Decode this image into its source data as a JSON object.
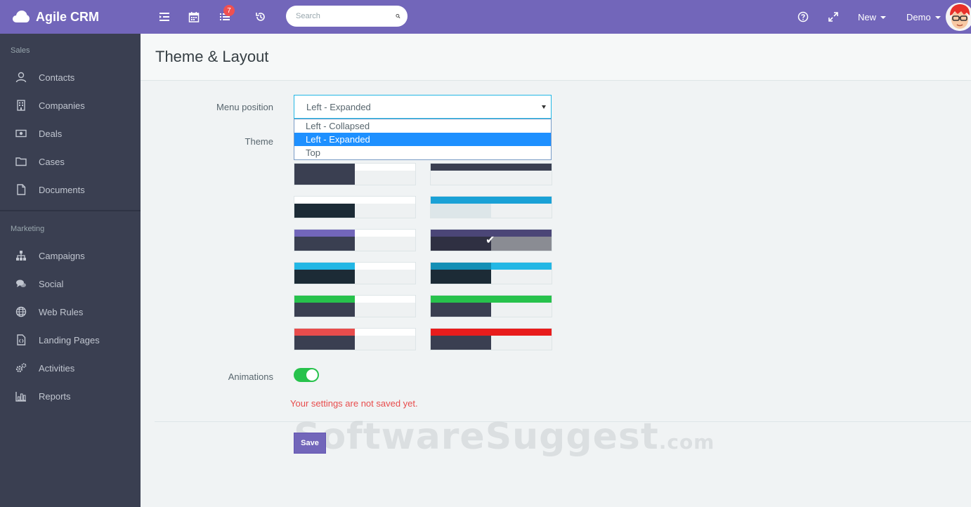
{
  "app": {
    "brand": "Agile CRM"
  },
  "topbar": {
    "notification_count": "7",
    "search_placeholder": "Search",
    "new_label": "New",
    "user_label": "Demo"
  },
  "sidebar": {
    "sales_section": "Sales",
    "sales_items": [
      {
        "label": "Contacts",
        "icon": "user-icon"
      },
      {
        "label": "Companies",
        "icon": "building-icon"
      },
      {
        "label": "Deals",
        "icon": "money-icon"
      },
      {
        "label": "Cases",
        "icon": "folder-icon"
      },
      {
        "label": "Documents",
        "icon": "file-icon"
      }
    ],
    "marketing_section": "Marketing",
    "marketing_items": [
      {
        "label": "Campaigns",
        "icon": "sitemap-icon"
      },
      {
        "label": "Social",
        "icon": "comments-icon"
      },
      {
        "label": "Web Rules",
        "icon": "globe-icon"
      },
      {
        "label": "Landing Pages",
        "icon": "file-code-icon"
      },
      {
        "label": "Activities",
        "icon": "cogs-icon"
      },
      {
        "label": "Reports",
        "icon": "bar-chart-icon"
      }
    ]
  },
  "page": {
    "title": "Theme & Layout",
    "menu_position_label": "Menu position",
    "menu_position_value": "Left - Expanded",
    "menu_position_options": [
      "Left - Collapsed",
      "Left - Expanded",
      "Top"
    ],
    "selected_option_index": 1,
    "theme_label": "Theme",
    "animations_label": "Animations",
    "animations_enabled": true,
    "warning": "Your settings are not saved yet.",
    "save_label": "Save",
    "watermark": "SoftwareSuggest",
    "watermark_suffix": ".com"
  },
  "themes": [
    {
      "top": "#3a3f51",
      "left": "#3a3f51",
      "bar": "#ffffff",
      "selected": false
    },
    {
      "top": "#3a3f51",
      "left": "#eef1f2",
      "bar": "#3a3f51",
      "selected": false
    },
    {
      "top": "#ffffff",
      "left": "#1c2b36",
      "bar": "#ffffff",
      "selected": false
    },
    {
      "top": "#1aa1d6",
      "left": "#dde6e9",
      "bar": "#1aa1d6",
      "selected": false
    },
    {
      "top": "#7266ba",
      "left": "#3a3f51",
      "bar": "#ffffff",
      "selected": false
    },
    {
      "top": "#4b4677",
      "left": "#2f3042",
      "bar": "#4b4677",
      "right": "#8a8c93",
      "selected": true
    },
    {
      "top": "#23b7e5",
      "left": "#1c2b36",
      "bar": "#ffffff",
      "selected": false
    },
    {
      "top": "#138fb5",
      "left": "#1c2b36",
      "bar": "#23b7e5",
      "selected": false
    },
    {
      "top": "#27c24c",
      "left": "#3a3f51",
      "bar": "#ffffff",
      "selected": false
    },
    {
      "top": "#27c24c",
      "left": "#3a3f51",
      "bar": "#27c24c",
      "selected": false
    },
    {
      "top": "#e84c4c",
      "left": "#3a3f51",
      "bar": "#ffffff",
      "selected": false
    },
    {
      "top": "#e81c1c",
      "left": "#3a3f51",
      "bar": "#e81c1c",
      "selected": false
    }
  ],
  "colors": {
    "accent": "#7266ba",
    "sidebar": "#3a3f51",
    "toggle_on": "#27c24c",
    "warning": "#e84c4c",
    "badge": "#f05050"
  }
}
